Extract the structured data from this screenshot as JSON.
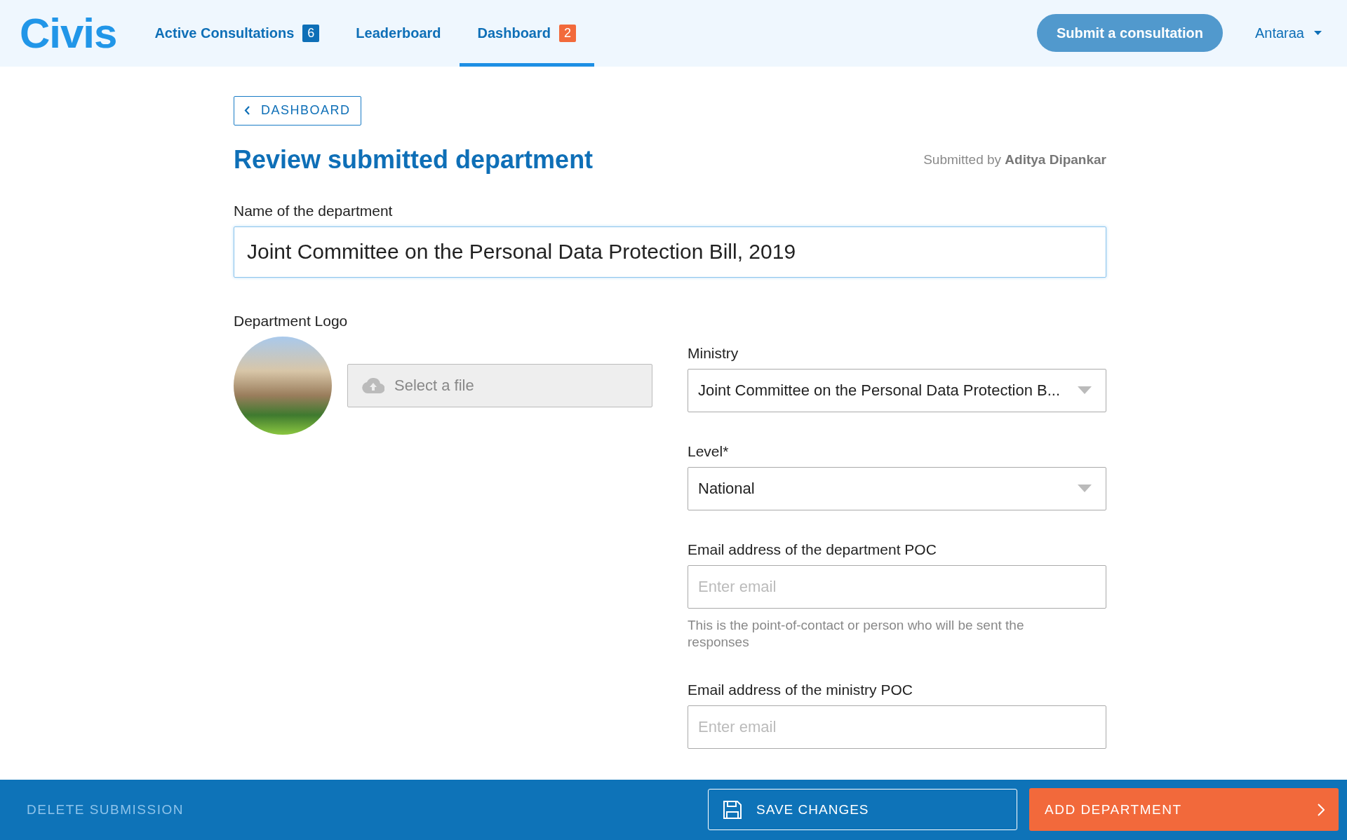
{
  "header": {
    "logo": "Civis",
    "nav": [
      {
        "label": "Active Consultations",
        "badge": "6",
        "color": "#0e6fb7",
        "selected": false
      },
      {
        "label": "Leaderboard",
        "selected": false
      },
      {
        "label": "Dashboard",
        "badge": "2",
        "color": "#f26a3b",
        "selected": true
      }
    ],
    "submit_button": "Submit a consultation",
    "user": "Antaraa"
  },
  "back_button": "DASHBOARD",
  "title": "Review submitted department",
  "submitted_by": "Submitted by **Aditya Dipankar**",
  "name_field": {
    "label": "Name of the department",
    "value": "Joint Committee on the Personal Data Protection Bill, 2019"
  },
  "logo": {
    "label": "Department Logo",
    "upload_button": "Select a file"
  },
  "ministry": {
    "label": "Ministry",
    "value": "Joint Committee on the Personal Data Protection B..."
  },
  "level": {
    "label": "Level*",
    "value": "National"
  },
  "department_email": {
    "label": "Email address of the department POC",
    "placeholder": "Enter email",
    "help": "This is the point-of-contact or person who will be sent the responses"
  },
  "ministry_email": {
    "label": "Email address of the ministry POC",
    "placeholder": "Enter email"
  },
  "footer": {
    "delete": "DELETE SUBMISSION",
    "save": "SAVE CHANGES",
    "add": "ADD DEPARTMENT"
  }
}
